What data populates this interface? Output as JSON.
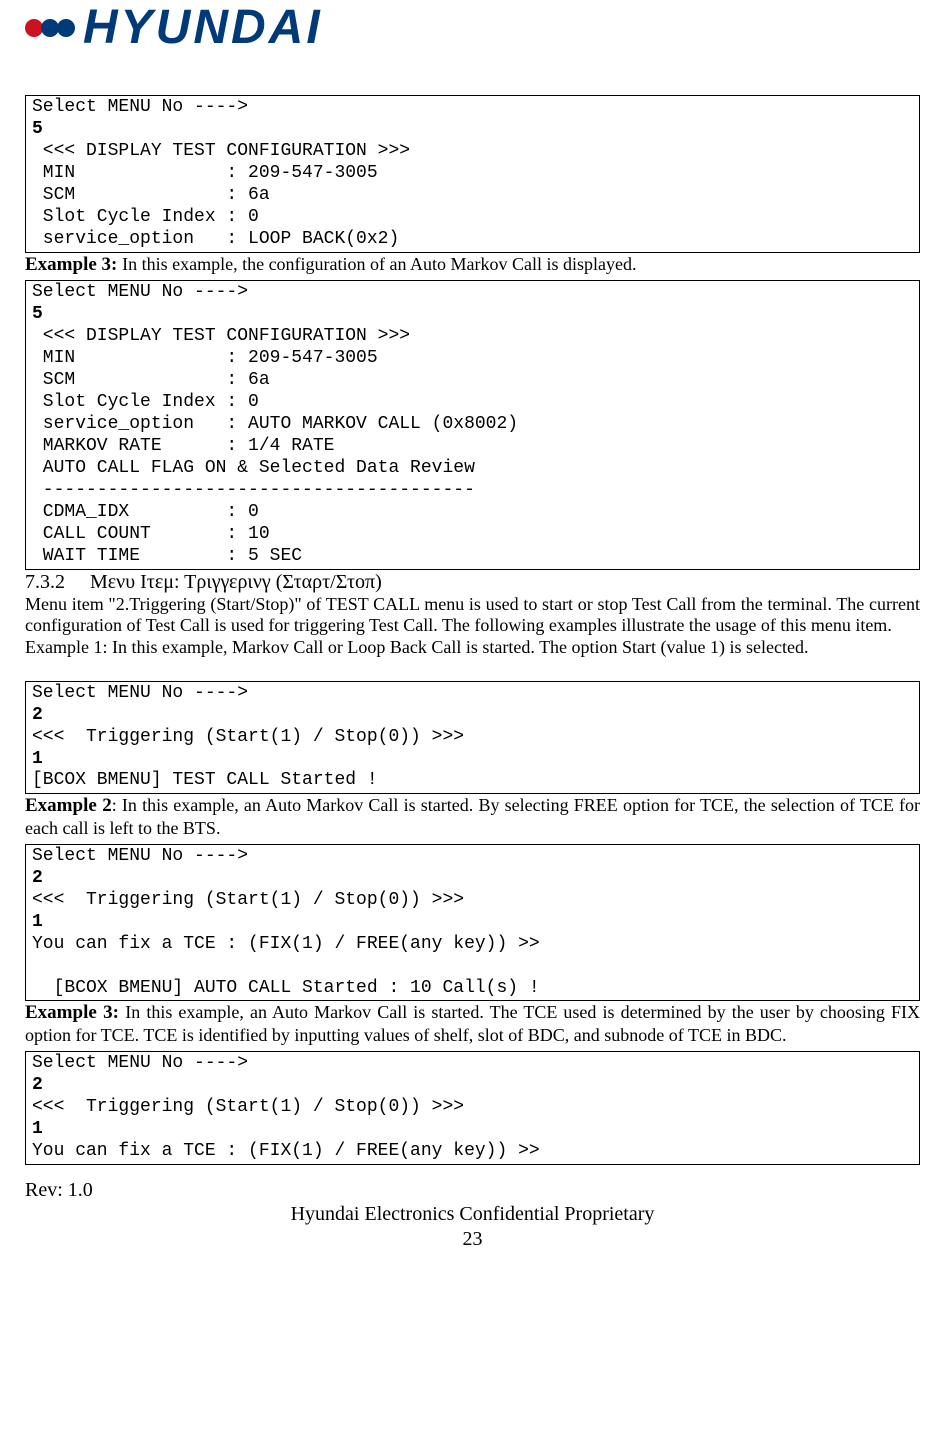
{
  "logo": {
    "brand_text": "HYUNDAI"
  },
  "code_block_1": {
    "l1": "Select MENU No ---->",
    "l2": "5",
    "l3": " <<< DISPLAY TEST CONFIGURATION >>>",
    "l4": " MIN              : 209-547-3005",
    "l5": " SCM              : 6a",
    "l6": " Slot Cycle Index : 0",
    "l7": " service_option   : LOOP BACK(0x2)"
  },
  "example3a_title": "Example 3: ",
  "example3a_text": "In this example, the configuration of an Auto Markov Call is displayed.",
  "code_block_2": {
    "l1": "Select MENU No ---->",
    "l2": "5",
    "l3": " <<< DISPLAY TEST CONFIGURATION >>>",
    "l4": " MIN              : 209-547-3005",
    "l5": " SCM              : 6a",
    "l6": " Slot Cycle Index : 0",
    "l7": " service_option   : AUTO MARKOV CALL (0x8002)",
    "l8": " MARKOV RATE      : 1/4 RATE",
    "l9": " AUTO CALL FLAG ON & Selected Data Review",
    "l10": " ----------------------------------------",
    "l11": " CDMA_IDX         : 0",
    "l12": " CALL COUNT       : 10",
    "l13": " WAIT TIME        : 5 SEC"
  },
  "section_heading_num": "7.3.2",
  "section_heading_text": "Μενυ Ιτεμ: Τριγγερινγ (Σταρτ/Στοπ)",
  "para1": "Menu item \"2.Triggering (Start/Stop)\" of TEST CALL menu is used to start or stop Test Call from the terminal. The current configuration of Test Call is used for triggering Test Call. The following examples illustrate the usage of this menu item.",
  "para1b": "Example 1: In this example, Markov Call or Loop Back Call is started. The option Start (value 1) is selected.",
  "code_block_3": {
    "l1": "Select MENU No ---->",
    "l2": "2",
    "l3": "<<<  Triggering (Start(1) / Stop(0)) >>>",
    "l4": "1",
    "l5": "[BCOX BMENU] TEST CALL Started !"
  },
  "example2_title": "Example 2",
  "example2_text": ": In this example, an Auto Markov Call is started. By selecting FREE option for TCE, the selection of TCE for each call is left to the BTS.",
  "code_block_4": {
    "l1": "Select MENU No ---->",
    "l2": "2",
    "l3": "<<<  Triggering (Start(1) / Stop(0)) >>>",
    "l4": "1",
    "l5": "You can fix a TCE : (FIX(1) / FREE(any key)) >>",
    "l6": "",
    "l7": "  [BCOX BMENU] AUTO CALL Started : 10 Call(s) !"
  },
  "example3b_title": "Example 3: ",
  "example3b_text": "In this example, an Auto Markov Call is started. The TCE used is determined by the user by choosing FIX option for TCE. TCE is identified by inputting values of shelf, slot of BDC, and subnode of TCE in BDC.",
  "code_block_5": {
    "l1": "Select MENU No ---->",
    "l2": "2",
    "l3": "<<<  Triggering (Start(1) / Stop(0)) >>>",
    "l4": "1",
    "l5": "You can fix a TCE : (FIX(1) / FREE(any key)) >>"
  },
  "footer": {
    "rev": "Rev: 1.0",
    "conf": "Hyundai Electronics Confidential Proprietary",
    "page": "23"
  }
}
